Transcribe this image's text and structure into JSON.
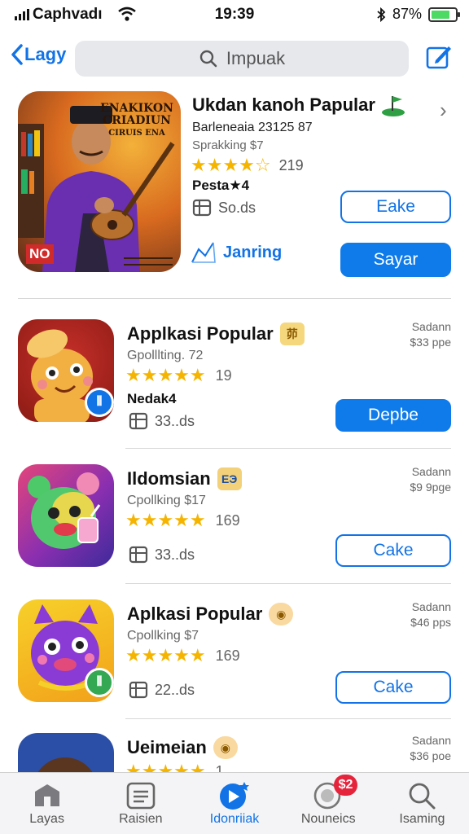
{
  "status": {
    "carrier": "Caphvadı",
    "time": "19:39",
    "battery": "87%"
  },
  "nav": {
    "back_label": "Lagy",
    "search_placeholder": "Impuak"
  },
  "featured": {
    "poster_lines": [
      "ENAKIKON",
      "CRIADIUN",
      "CIRUIS ENA"
    ],
    "poster_badge": "NO",
    "title": "Ukdan kanoh Papular",
    "subtitle": "Barleneaia 23125 87",
    "subtitle2": "Sprakking $7",
    "stars": "★★★★☆",
    "rating_count": "219",
    "price_label": "Pesta★4",
    "size": "So.ds",
    "link_label": "Janring",
    "outline_button": "Eake",
    "solid_button": "Sayar"
  },
  "apps": [
    {
      "title": "Applkasi Popular",
      "emblem": "茆",
      "subtitle": "Gpolllting. 72",
      "stars": "★★★★★",
      "rating_count": "19",
      "price_label": "Nedak4",
      "size": "33..ds",
      "meta1": "Sadann",
      "meta2": "$33 ppe",
      "button": "Depbe",
      "button_style": "solid"
    },
    {
      "title": "Ildomsian",
      "emblem": "ЕЭ",
      "subtitle": "Cpollking $17",
      "stars": "★★★★★",
      "rating_count": "169",
      "price_label": "",
      "size": "33..ds",
      "meta1": "Sadann",
      "meta2": "$9 9pge",
      "button": "Cake",
      "button_style": "outline"
    },
    {
      "title": "Aplkasi Popular",
      "emblem": "◉",
      "subtitle": "Cpollking $7",
      "stars": "★★★★★",
      "rating_count": "169",
      "price_label": "",
      "size": "22..ds",
      "meta1": "Sadann",
      "meta2": "$46 pps",
      "button": "Cake",
      "button_style": "outline"
    },
    {
      "title": "Ueimeian",
      "emblem": "◉",
      "subtitle": "",
      "stars": "★★★★★",
      "rating_count": "1",
      "price_label": "",
      "size": "",
      "meta1": "Sadann",
      "meta2": "$36 poe",
      "button": "",
      "button_style": "none"
    }
  ],
  "tabs": [
    {
      "label": "Layas",
      "icon": "home-icon"
    },
    {
      "label": "Raisien",
      "icon": "list-icon"
    },
    {
      "label": "Idonriiak",
      "icon": "play-icon"
    },
    {
      "label": "Nouneics",
      "icon": "bubble-icon",
      "badge": "$2"
    },
    {
      "label": "Isaming",
      "icon": "search-icon"
    }
  ],
  "colors": {
    "accent": "#1273e6",
    "star": "#f5b400",
    "badge": "#e5243b"
  }
}
